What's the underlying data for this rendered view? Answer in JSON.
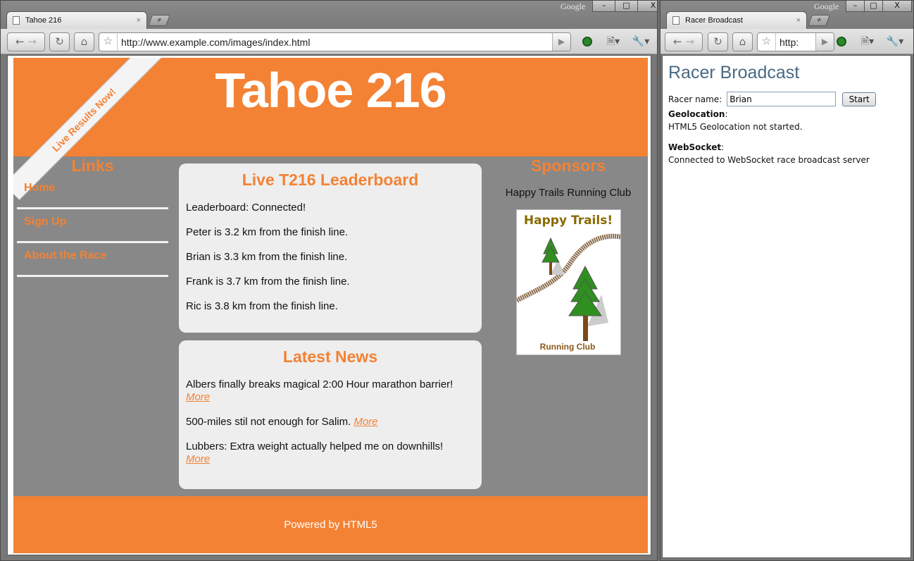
{
  "left_window": {
    "google_label": "Google",
    "window_controls": [
      "–",
      "□",
      "X"
    ],
    "tab": {
      "title": "Tahoe 216",
      "close": "×"
    },
    "new_tab": "+",
    "url": "http://www.example.com/images/index.html"
  },
  "right_window": {
    "google_label": "Google",
    "window_controls": [
      "–",
      "□",
      "X"
    ],
    "tab": {
      "title": "Racer Broadcast",
      "close": "×"
    },
    "new_tab": "+",
    "url": "http:"
  },
  "tahoe": {
    "site_title": "Tahoe 216",
    "ribbon": "Live Results Now!",
    "links": {
      "heading": "Links",
      "items": [
        "Home",
        "Sign Up",
        "About the Race"
      ]
    },
    "leaderboard": {
      "heading": "Live T216 Leaderboard",
      "status": "Leaderboard: Connected!",
      "entries": [
        "Peter is 3.2 km from the finish line.",
        "Brian is 3.3 km from the finish line.",
        "Frank is 3.7 km from the finish line.",
        "Ric is 3.8 km from the finish line."
      ]
    },
    "news": {
      "heading": "Latest News",
      "more_label": "More",
      "items": [
        "Albers finally breaks magical 2:00 Hour marathon barrier!",
        "500-miles stil not enough for Salim.",
        "Lubbers: Extra weight actually helped me on downhills!"
      ]
    },
    "sponsors": {
      "heading": "Sponsors",
      "name": "Happy Trails Running Club",
      "image_title": "Happy Trails!",
      "image_caption": "Running Club"
    },
    "footer": "Powered by HTML5"
  },
  "racer": {
    "title": "Racer Broadcast",
    "name_label": "Racer name:",
    "name_value": "Brian",
    "start_label": "Start",
    "geo_label": "Geolocation",
    "geo_status": "HTML5 Geolocation not started.",
    "ws_label": "WebSocket",
    "ws_status": "Connected to WebSocket race broadcast server",
    "colon": ":"
  },
  "colors": {
    "accent_orange": "#f38234",
    "page_gray": "#888888",
    "panel_bg": "#eeeeee",
    "racer_title": "#4a6a84"
  }
}
